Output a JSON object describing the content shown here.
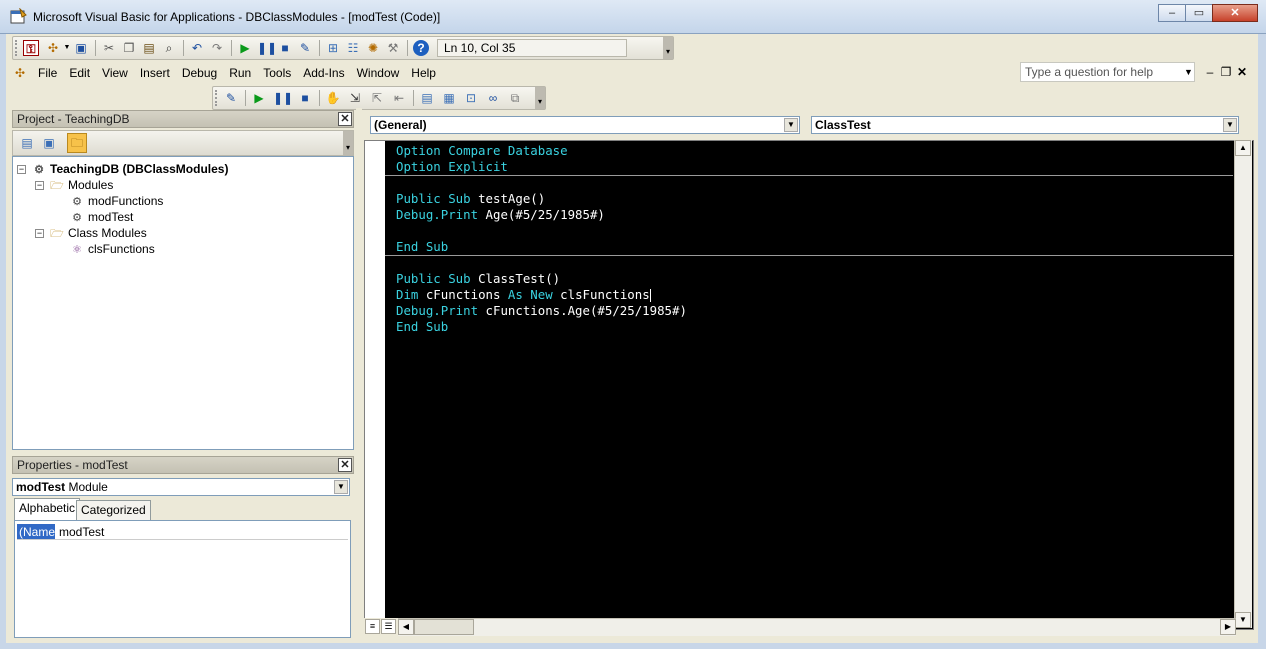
{
  "window": {
    "title": "Microsoft Visual Basic for Applications - DBClassModules - [modTest (Code)]",
    "controls": {
      "minimize": "–",
      "restore": "▭",
      "close": "✕"
    }
  },
  "toolbar": {
    "status": "Ln 10, Col 35"
  },
  "menu": {
    "items": [
      "File",
      "Edit",
      "View",
      "Insert",
      "Debug",
      "Run",
      "Tools",
      "Add-Ins",
      "Window",
      "Help"
    ],
    "help_placeholder": "Type a question for help"
  },
  "project": {
    "title": "Project - TeachingDB",
    "tree": {
      "root": "TeachingDB (DBClassModules)",
      "modules_folder": "Modules",
      "modules": [
        "modFunctions",
        "modTest"
      ],
      "class_folder": "Class Modules",
      "classes": [
        "clsFunctions"
      ]
    }
  },
  "properties": {
    "title": "Properties - modTest",
    "object_name": "modTest",
    "object_type": "Module",
    "tabs": [
      "Alphabetic",
      "Categorized"
    ],
    "rows": [
      {
        "name": "(Name)",
        "value": "modTest"
      }
    ]
  },
  "code": {
    "object_combo": "(General)",
    "proc_combo": "ClassTest",
    "lines": {
      "l1": [
        "Option Compare Database"
      ],
      "l2": [
        "Option Explicit"
      ],
      "l3_kw": "Public Sub",
      "l3_rest": " testAge()",
      "l4_kw": "Debug.Print",
      "l4_rest": " Age(#5/25/1985#)",
      "l5": "End Sub",
      "l6_kw": "Public Sub",
      "l6_rest": " ClassTest()",
      "l7_kw1": "Dim",
      "l7_mid": " cFunctions ",
      "l7_kw2": "As New",
      "l7_rest": " clsFunctions",
      "l8_kw": "Debug.Print",
      "l8_rest": " cFunctions.Age(#5/25/1985#)",
      "l9": "End Sub"
    }
  },
  "colors": {
    "keyword": "#3ad2e0",
    "code_background": "#000000",
    "selection": "#3169c6"
  }
}
